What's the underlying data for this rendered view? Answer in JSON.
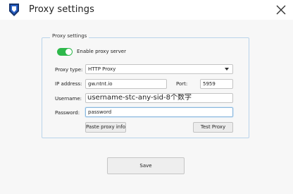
{
  "window": {
    "title": "Proxy settings"
  },
  "icons": {
    "app_logo": "app-logo-icon",
    "close": "close-icon",
    "dropdown": "chevron-down-icon"
  },
  "proxy_settings": {
    "group_title": "Proxy settings",
    "enable_proxy": {
      "label": "Enable proxy server",
      "checked": true
    },
    "proxy_type": {
      "label": "Proxy type:",
      "value": "HTTP Proxy"
    },
    "ip_address": {
      "label": "IP address:",
      "value": "gw.ntnt.io"
    },
    "port": {
      "label": "Port:",
      "value": "5959"
    },
    "username": {
      "label": "Username:",
      "value": "username-stc-any-sid-8个数字"
    },
    "password": {
      "label": "Password:",
      "value": "password"
    },
    "paste_button": "Paste proxy info",
    "test_button": "Test Proxy"
  },
  "footer": {
    "save_button": "Save"
  },
  "colors": {
    "accent_green": "#2eb84b",
    "group_border": "#b9d3ea",
    "logo_blue": "#1f5fc0"
  }
}
